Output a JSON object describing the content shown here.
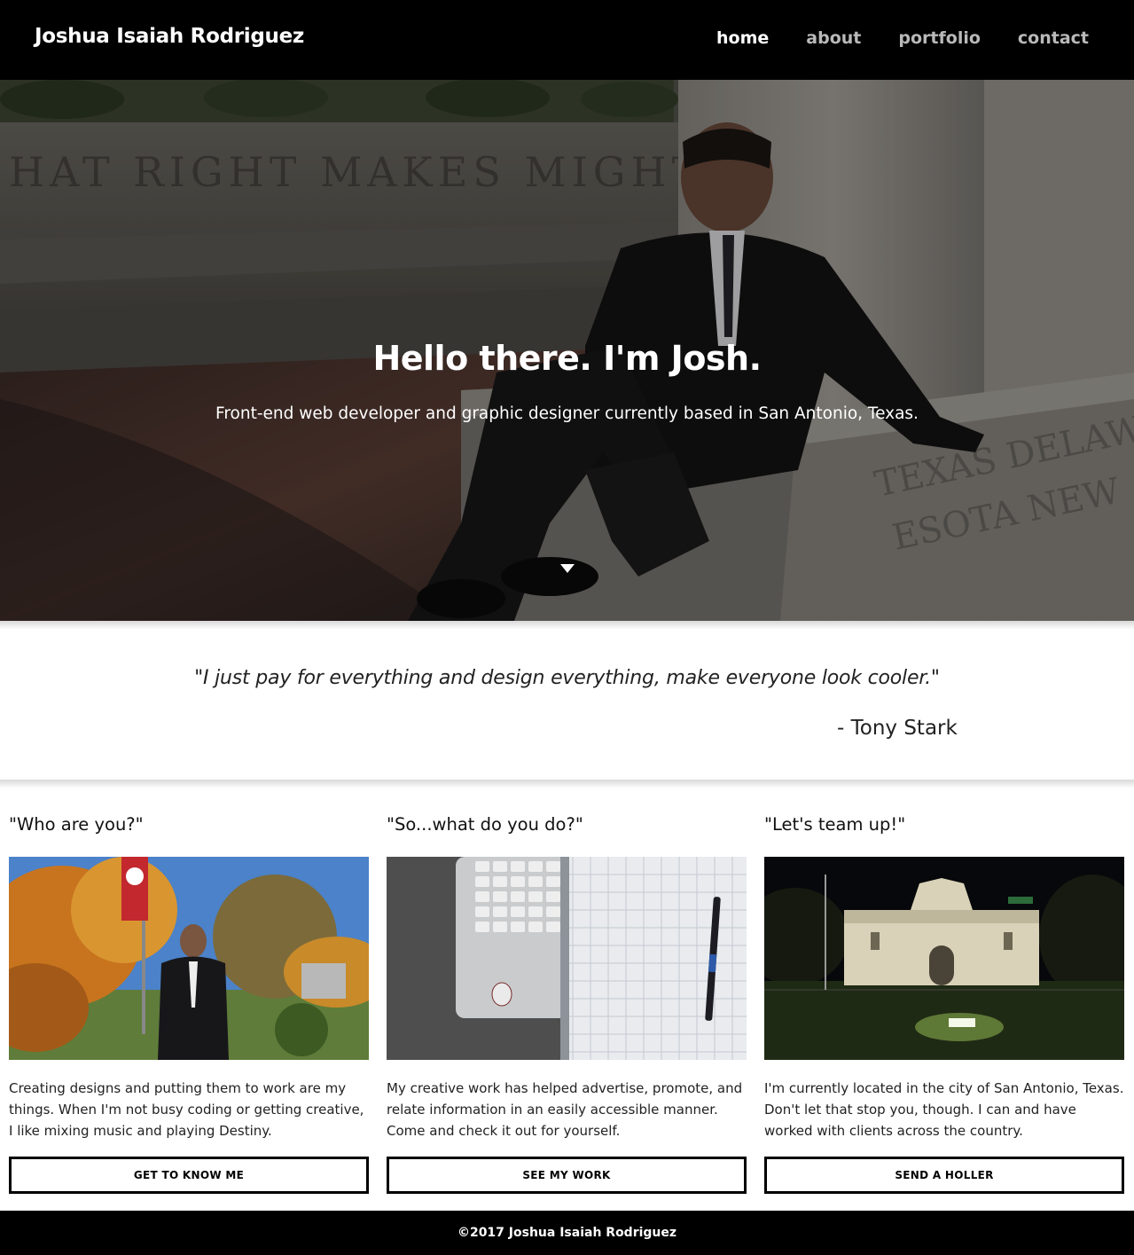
{
  "header": {
    "brand": "Joshua Isaiah Rodriguez",
    "nav": [
      {
        "label": "home",
        "active": true
      },
      {
        "label": "about",
        "active": false
      },
      {
        "label": "portfolio",
        "active": false
      },
      {
        "label": "contact",
        "active": false
      }
    ]
  },
  "hero": {
    "title": "Hello there. I'm Josh.",
    "subtitle": "Front-end web developer and graphic designer currently based in San Antonio, Texas.",
    "scroll_icon": "triangle-down"
  },
  "quote": {
    "text": "\"I just pay for everything and design everything, make everyone look cooler.\"",
    "author": "- Tony Stark"
  },
  "columns": [
    {
      "heading": "\"Who are you?\"",
      "image": "man in suit on campus with autumn trees",
      "body": "Creating designs and putting them to work are my things. When I'm not busy coding or getting creative, I like mixing music and playing Destiny.",
      "button": "GET TO KNOW ME"
    },
    {
      "heading": "\"So...what do you do?\"",
      "image": "laptop keyboard beside graph paper notebook and pen",
      "body": "My creative work has helped advertise, promote, and relate information in an easily accessible manner. Come and check it out for yourself.",
      "button": "SEE MY WORK"
    },
    {
      "heading": "\"Let's team up!\"",
      "image": "the Alamo lit at night",
      "body": "I'm currently located in the city of San Antonio, Texas. Don't let that stop you, though. I can and have worked with clients across the country.",
      "button": "SEND A HOLLER"
    }
  ],
  "footer": {
    "text": "©2017 Joshua Isaiah Rodriguez"
  },
  "colors": {
    "header_bg": "#000000",
    "nav_active": "#ffffff",
    "nav_inactive": "#b9b9b9",
    "footer_bg": "#000000"
  }
}
